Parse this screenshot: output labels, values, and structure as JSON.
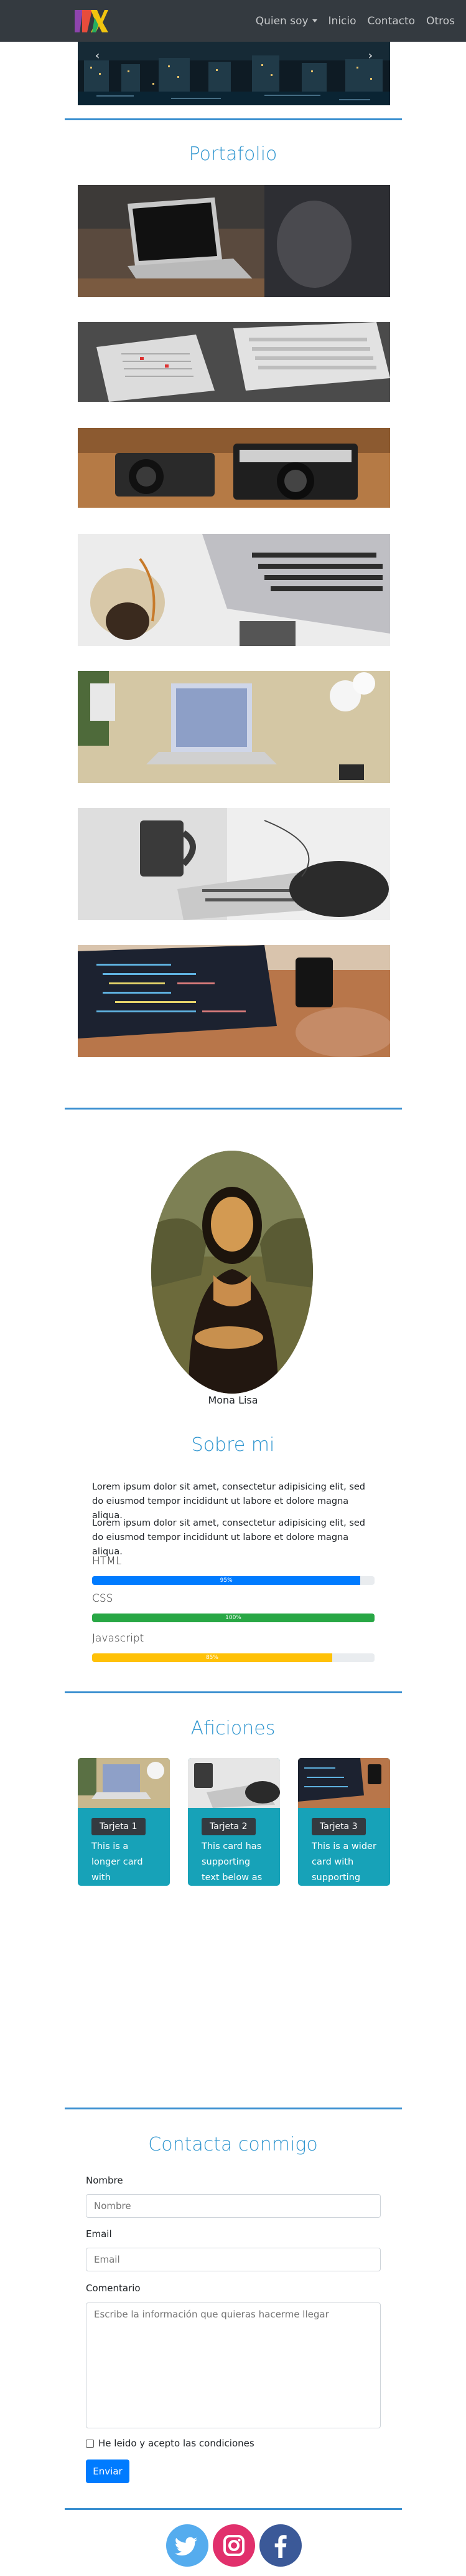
{
  "nav": {
    "logo_alt": "logo",
    "items": [
      {
        "label": "Quien soy"
      },
      {
        "label": "Inicio"
      },
      {
        "label": "Contacto"
      },
      {
        "label": "Otros"
      }
    ]
  },
  "portfolio": {
    "title": "Portafolio"
  },
  "about": {
    "caption": "Mona Lisa",
    "title": "Sobre mi",
    "paragraphs": [
      "Lorem ipsum dolor sit amet, consectetur adipisicing elit, sed do eiusmod tempor incididunt ut labore et dolore magna aliqua.",
      "Lorem ipsum dolor sit amet, consectetur adipisicing elit, sed do eiusmod tempor incididunt ut labore et dolore magna aliqua."
    ],
    "skills": [
      {
        "name": "HTML",
        "label": "95%",
        "percent": 95,
        "color": "#007bff"
      },
      {
        "name": "CSS",
        "label": "100%",
        "percent": 100,
        "color": "#28a745"
      },
      {
        "name": "Javascript",
        "label": "85%",
        "percent": 85,
        "color": "#ffc107"
      }
    ]
  },
  "hobbies": {
    "title": "Aficiones",
    "cards": [
      {
        "badge": "Tarjeta 1",
        "text": "This is a longer card with supporting text below as a natural lead-in to additional content. This content is a little bit longer."
      },
      {
        "badge": "Tarjeta 2",
        "text": "This card has supporting text below as a natural lead-in to additional content."
      },
      {
        "badge": "Tarjeta 3",
        "text": "This is a wider card with supporting text below as a natural lead-in to additional content. This card has even longer content than the first to show that equal height action."
      }
    ]
  },
  "contact": {
    "title": "Contacta conmigo",
    "name_label": "Nombre",
    "name_placeholder": "Nombre",
    "email_label": "Email",
    "email_placeholder": "Email",
    "comment_label": "Comentario",
    "comment_placeholder": "Escribe la información que quieras hacerme llegar",
    "terms_label": "He leido y acepto las condiciones",
    "submit_label": "Enviar"
  },
  "social": [
    {
      "icon": "twitter-icon",
      "color": "#55acee"
    },
    {
      "icon": "instagram-icon",
      "color": "#e1306c"
    },
    {
      "icon": "facebook-icon",
      "color": "#3b5998"
    }
  ]
}
